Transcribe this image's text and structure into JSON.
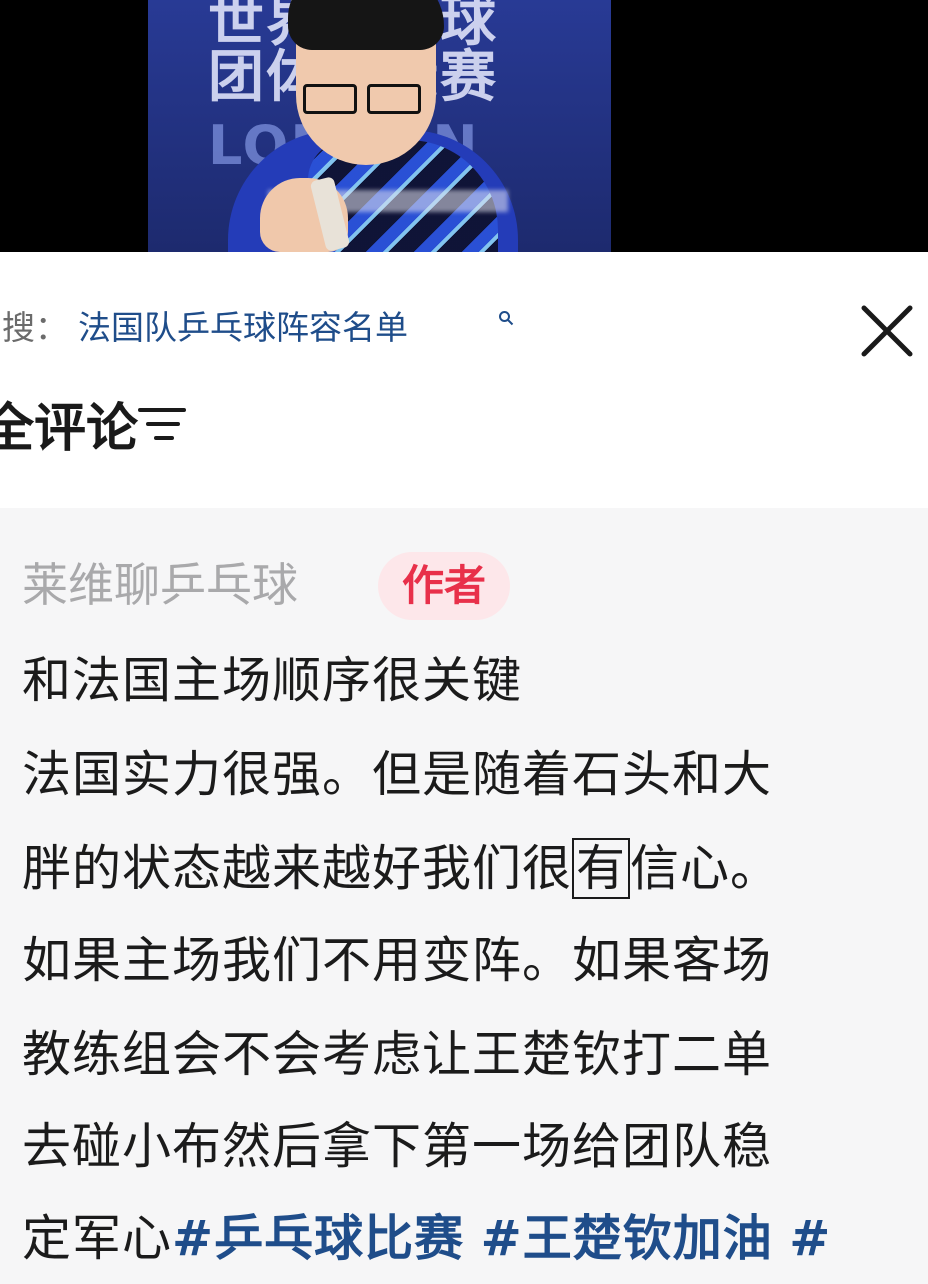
{
  "video": {
    "overlay_text_line1": "世界乒乓球",
    "overlay_text_line2": "团体锦标赛",
    "overlay_text_line3": "LONDON"
  },
  "search": {
    "prefix": "搜：",
    "query": "法国队乒乓球阵容名单"
  },
  "comments": {
    "title": "全评论"
  },
  "comment": {
    "author": "莱维聊乒乓球",
    "badge": "作者",
    "line1": "和法国主场顺序很关键",
    "line2": "法国实力很强。但是随着石头和大",
    "line3_a": "胖的状态越来越好我们很",
    "line3_boxed": "有",
    "line3_b": "信心。",
    "line4": "如果主场我们不用变阵。如果客场",
    "line5": "教练组会不会考虑让王楚钦打二单",
    "line6": "去碰小布然后拿下第一场给团队稳",
    "line7_text": "定军心",
    "tags": [
      "#乒乓球比赛",
      "#王楚钦加油",
      "#"
    ]
  },
  "colors": {
    "link_blue": "#1f4d8a",
    "badge_red": "#e8304a",
    "badge_bg": "#fde7ea",
    "card_bg": "#f6f6f7"
  },
  "icons": {
    "close": "close-icon",
    "sort": "sort-icon",
    "search": "search-icon"
  }
}
